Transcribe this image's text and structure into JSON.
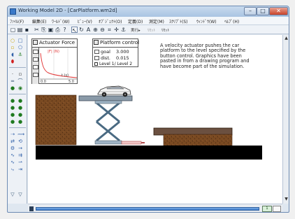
{
  "window": {
    "title": "Working Model 2D - [CarPlatform.wm2d]",
    "controls": {
      "minimize": "–",
      "maximize": "□",
      "close": "✕"
    }
  },
  "menubar": {
    "items": [
      "ﾌｧｲﾙ(F)",
      "編集(E)",
      "ﾜｰﾙﾄﾞ(W)",
      "ﾋﾞｭｰ(V)",
      "ｵﾌﾞｼﾞｪｸﾄ(O)",
      "定義(D)",
      "測定(M)",
      "ｽｸﾘﾌﾟﾄ(S)",
      "ｳｨﾝﾄﾞｳ(W)",
      "ﾍﾙﾌﾟ(H)"
    ]
  },
  "toolbar": {
    "run_label": "実行▸",
    "stop_label": "ﾘｾｯﾄ",
    "reset_label": "ﾘｾｯﾄ"
  },
  "meters": {
    "force": {
      "title": "Actuator Force",
      "series_label": "|F| (N)",
      "x_axis_label": "t (s)",
      "x_tick_end": "5.0",
      "x_tick_start": "0.0"
    },
    "control": {
      "title": "Platform control",
      "goal_label": "goal",
      "goal_value": "3.000",
      "dist_label": "dist.",
      "dist_value": "0.015",
      "level_text": "Level 1/ Level 2"
    }
  },
  "description": "A velocity actuator pushes the car platform to the level specified by the button control. Graphics have been pasted in from a drawing program and have become part of the simulation.",
  "player": {
    "counter_text": "1"
  },
  "colors": {
    "brick": "#7a4a22",
    "brick_dark": "#4f2d12",
    "platform": "#8a9aa8",
    "scissor": "#4a6a82",
    "ground": "#000000",
    "accent": "#3b78c7"
  }
}
